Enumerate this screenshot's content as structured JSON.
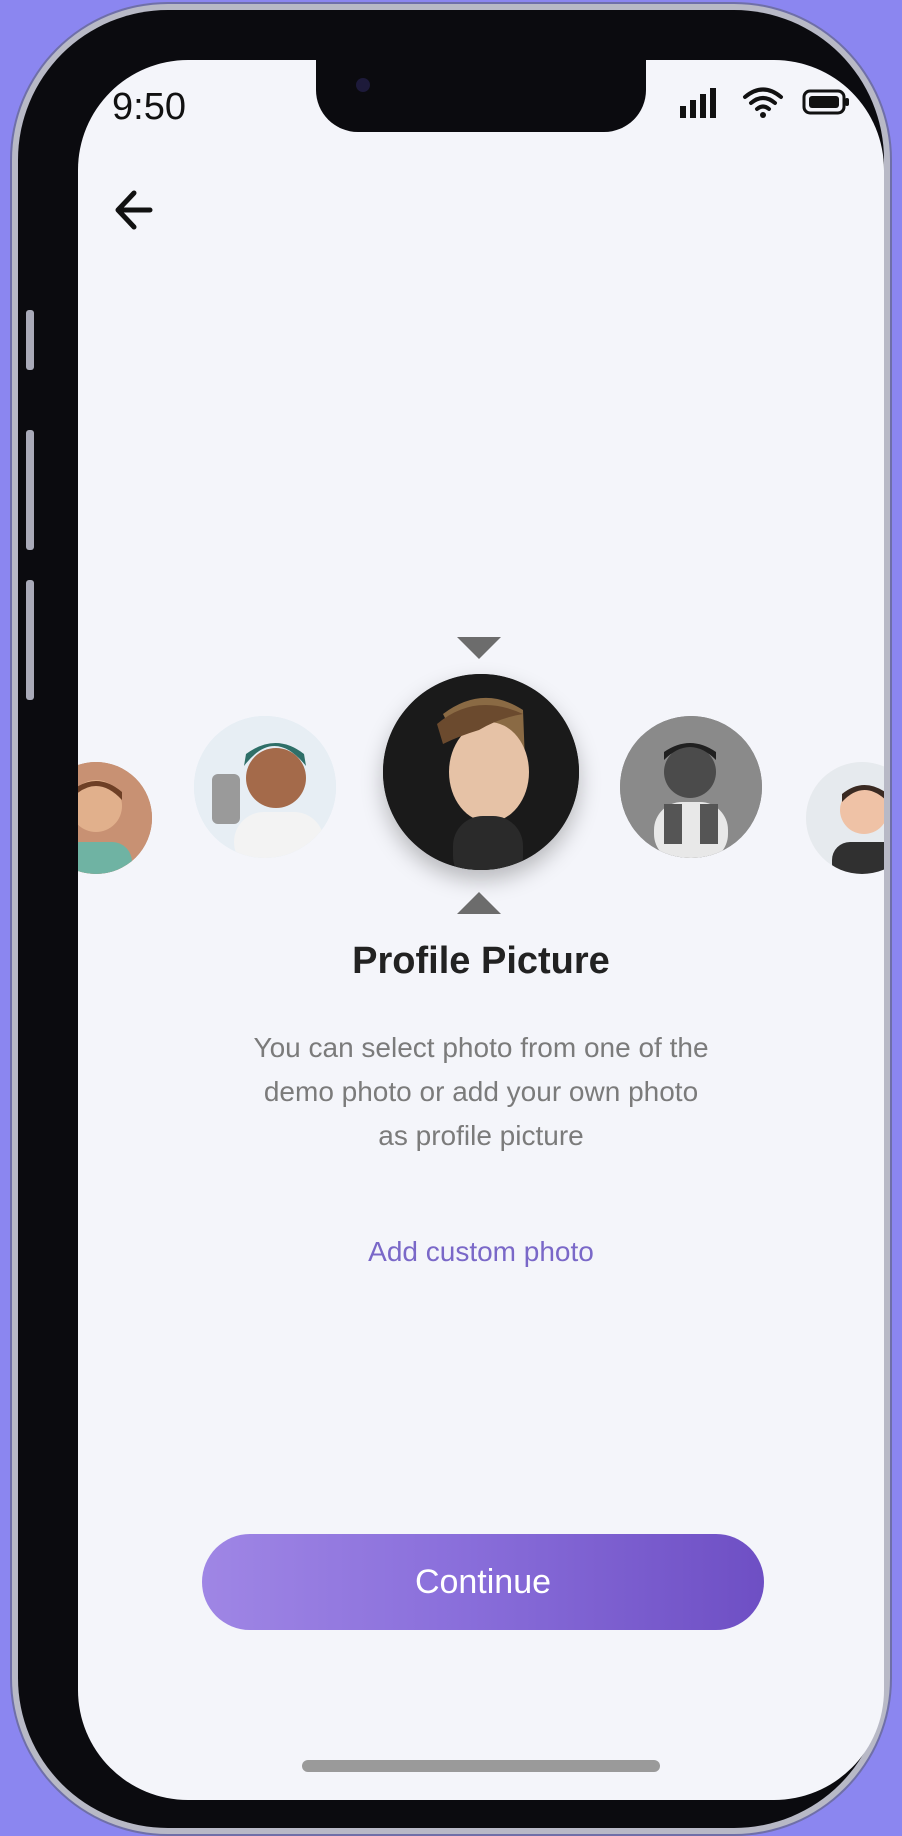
{
  "status_bar": {
    "time": "9:50",
    "icons": [
      "signal-icon",
      "wifi-icon",
      "battery-icon"
    ]
  },
  "header": {
    "back_icon": "arrow-left-icon"
  },
  "carousel": {
    "items": [
      {
        "name": "avatar-1",
        "selected": false
      },
      {
        "name": "avatar-2",
        "selected": false
      },
      {
        "name": "avatar-3",
        "selected": true
      },
      {
        "name": "avatar-4",
        "selected": false
      },
      {
        "name": "avatar-5",
        "selected": false
      }
    ]
  },
  "content": {
    "title": "Profile Picture",
    "description_lines": [
      "You can select photo from one of the",
      "demo photo or add your own photo",
      "as profile picture"
    ],
    "link": "Add custom photo"
  },
  "actions": {
    "continue_label": "Continue"
  },
  "colors": {
    "background": "#8b86f0",
    "screen": "#f4f5fa",
    "accent": "#7a68c8"
  }
}
